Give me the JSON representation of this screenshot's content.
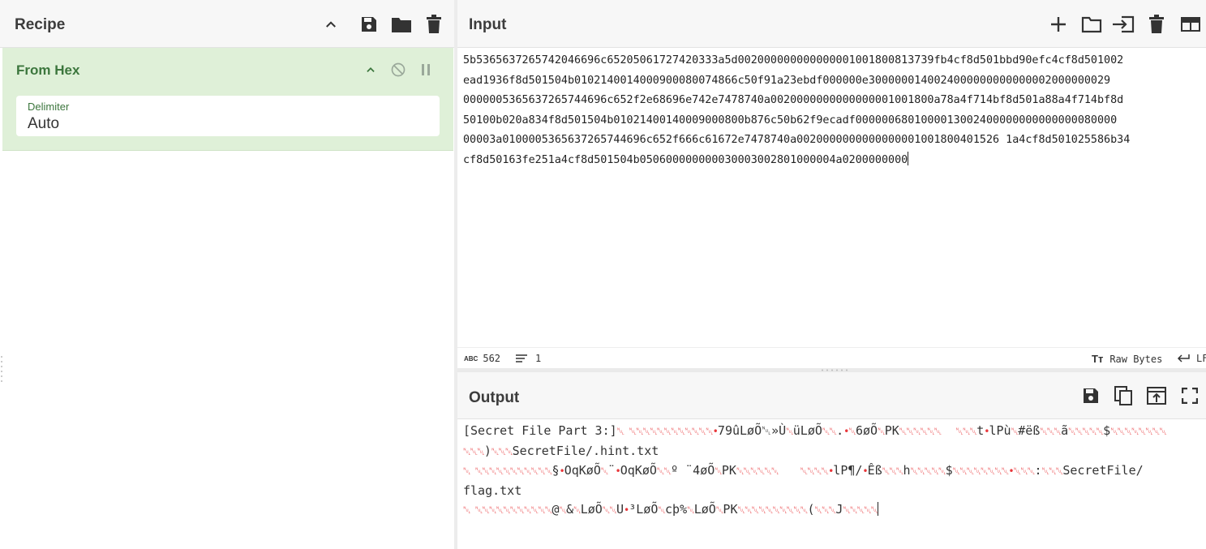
{
  "recipe": {
    "title": "Recipe",
    "icons": [
      "chevron-up-icon",
      "save-icon",
      "folder-icon",
      "trash-icon"
    ],
    "operation": {
      "name": "From Hex",
      "delimiter_label": "Delimiter",
      "delimiter_value": "Auto"
    }
  },
  "input": {
    "title": "Input",
    "lines": [
      "5b5365637265742046696c65205061727420333a5d002000000000000001001800813739fb4cf8d501bbd90efc4cf8d501002",
      "ead1936f8d501504b0102140014000900080074866c50f91a23ebdf000000e3000000140024000000000000002000000029",
      "0000005365637265744696c652f2e68696e742e7478740a0020000000000000001001800a78a4f714bf8d501a88a4f714bf8d",
      "50100b020a834f8d501504b01021400140009000800b876c50b62f9ecadf0000006801000013002400000000000000080000",
      "00003a0100005365637265744696c652f666c61672e7478740a0020000000000000001001800401526 1a4cf8d501025586b34",
      "cf8d50163fe251a4cf8d501504b050600000000030003002801000004a0200000000"
    ],
    "stats": {
      "length": "562",
      "lines": "1",
      "encoding": "Raw Bytes",
      "eol": "LF"
    }
  },
  "output": {
    "title": "Output",
    "segments": [
      [
        "[Secret File Part 3:]",
        "␀ ␀␀␀␀␀␀␀␀␀␀␀␀•",
        "79ûL",
        "ø",
        "Õ",
        "␀»",
        "Ù",
        "␀",
        "üL",
        "ø",
        "Õ",
        "␀␀",
        ".",
        "•",
        "␀",
        "6",
        "ø",
        "Õ",
        "␀",
        "PK",
        "␀␀␀␀␀␀",
        "  ",
        "␀␀␀",
        "t",
        "•",
        "lPù",
        "␀",
        "#ëß",
        "␀␀␀",
        "ã",
        "␀␀␀␀␀",
        "$",
        "␀␀␀␀␀␀␀␀"
      ],
      [
        "",
        "␀␀␀",
        ")",
        "␀␀␀",
        "SecretFile/.hint.txt"
      ],
      [
        "",
        "␀ ␀␀␀␀␀␀␀␀␀␀␀",
        "§",
        "•",
        "OqK",
        "ø",
        "Õ",
        "␀",
        "¨",
        "•",
        "OqK",
        "ø",
        "Õ",
        "␀␀",
        "º ¨4",
        "ø",
        "Õ",
        "␀",
        "PK",
        "␀␀␀␀␀␀",
        "   ",
        "␀␀␀␀",
        "•",
        "lP¶/",
        "•",
        "Êß",
        "␀␀␀",
        "h",
        "␀␀␀␀␀",
        "$",
        "␀␀␀␀␀␀␀␀",
        "•",
        "␀␀␀",
        ":",
        "␀␀␀",
        "SecretFile/"
      ],
      [
        "flag.txt"
      ],
      [
        "",
        "␀ ␀␀␀␀␀␀␀␀␀␀␀",
        "@",
        "␀",
        "&",
        "␀",
        "L",
        "ø",
        "Õ",
        "␀␀",
        "U",
        "•",
        "³L",
        "ø",
        "Õ",
        "␀",
        "cþ%",
        "␀",
        "L",
        "ø",
        "Õ",
        "␀",
        "PK",
        "␀␀␀␀␀␀␀␀␀␀",
        "(",
        "␀␀␀",
        "J",
        "␀␀␀␀␀"
      ]
    ]
  },
  "colors": {
    "accent_green": "#3c763d",
    "operation_bg": "#dff0d8",
    "control_char": "#e8363a"
  }
}
